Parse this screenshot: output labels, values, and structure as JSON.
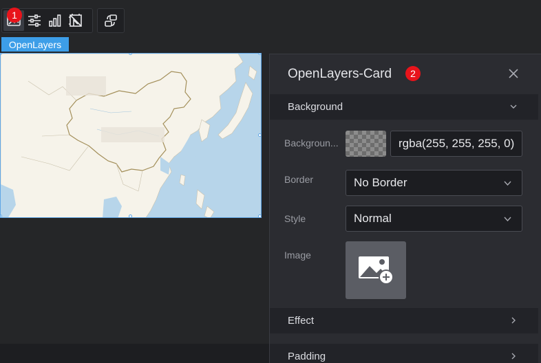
{
  "toolbar": {
    "badge": "1",
    "tools": [
      {
        "icon": "image-icon",
        "active": true
      },
      {
        "icon": "sliders-icon",
        "active": false
      },
      {
        "icon": "bar-chart-icon",
        "active": false
      },
      {
        "icon": "crop-icon",
        "active": false
      }
    ],
    "extra_icon": "refresh-link-icon"
  },
  "component": {
    "tag": "OpenLayers"
  },
  "panel": {
    "title": "OpenLayers-Card",
    "badge": "2",
    "sections": {
      "background": "Background",
      "effect": "Effect",
      "padding": "Padding"
    },
    "rows": {
      "background_label": "Backgroun...",
      "background_value": "rgba(255, 255, 255, 0)",
      "border_label": "Border",
      "border_value": "No Border",
      "style_label": "Style",
      "style_value": "Normal",
      "image_label": "Image"
    }
  },
  "colors": {
    "accent": "#3d9ee8",
    "badge": "#e8141b",
    "panel_bg": "#2b2c31",
    "map_water": "#b7d5ea",
    "map_land": "#f6f3ea"
  }
}
